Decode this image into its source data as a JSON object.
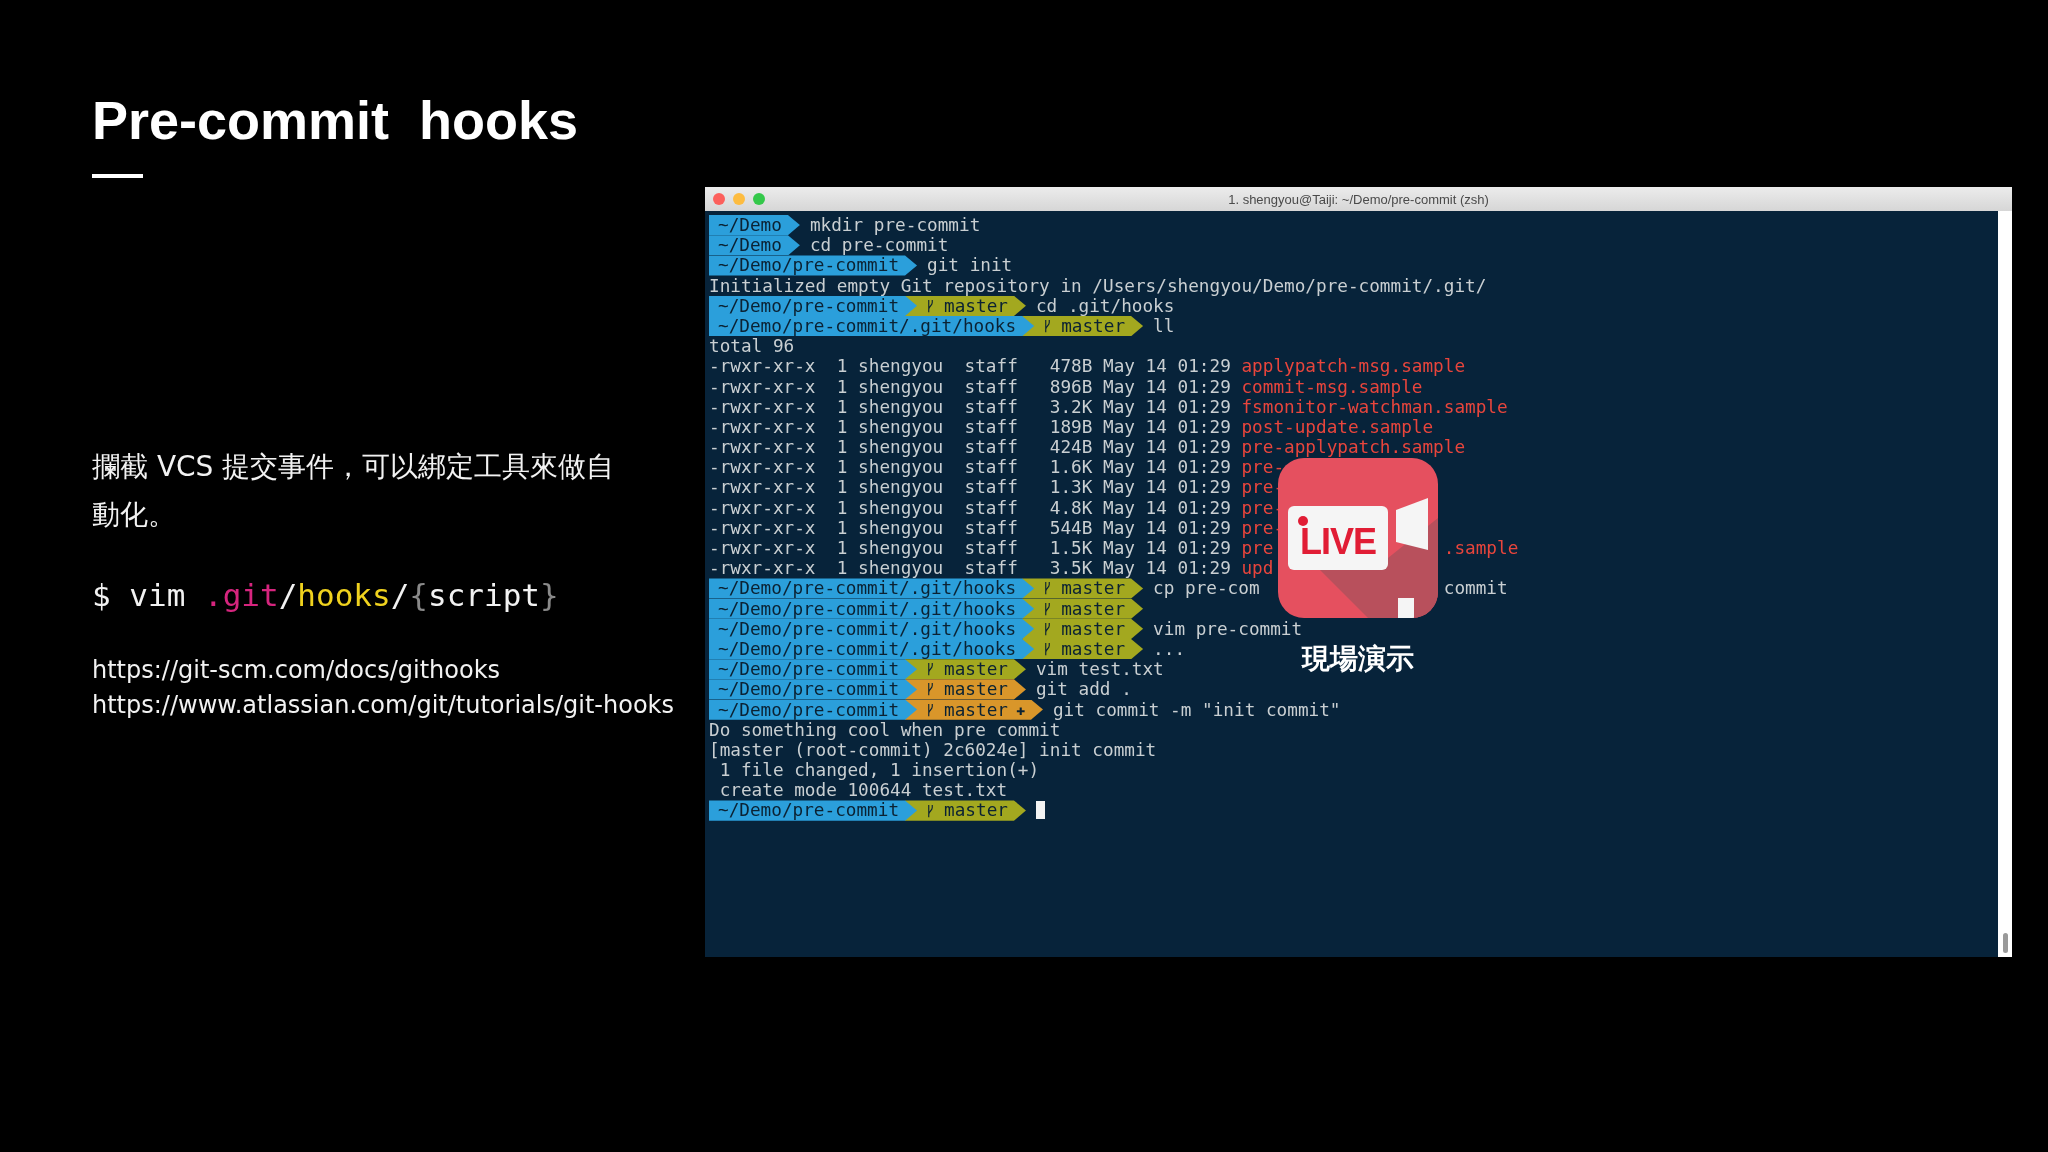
{
  "slide": {
    "title": "Pre-commit  hooks",
    "description": "攔截 VCS 提交事件，可以綁定工具來做自動化。",
    "command": [
      {
        "text": "$ vim ",
        "color": "#f2f2f2"
      },
      {
        "text": ".git",
        "color": "#d6257e"
      },
      {
        "text": "/",
        "color": "#f2f2f2"
      },
      {
        "text": "hooks",
        "color": "#f0d21e"
      },
      {
        "text": "/",
        "color": "#f2f2f2"
      },
      {
        "text": "{",
        "color": "#8a8a8a"
      },
      {
        "text": "script",
        "color": "#f2f2f2"
      },
      {
        "text": "}",
        "color": "#8a8a8a"
      }
    ],
    "links": [
      "https://git-scm.com/docs/githooks",
      "https://www.atlassian.com/git/tutorials/git-hooks"
    ]
  },
  "terminal": {
    "title": "1. shengyou@Taiji: ~/Demo/pre-commit (zsh)",
    "lines": [
      {
        "kind": "prompt",
        "path": "~/Demo",
        "command": "mkdir pre-commit"
      },
      {
        "kind": "prompt",
        "path": "~/Demo",
        "command": "cd pre-commit"
      },
      {
        "kind": "prompt",
        "path": "~/Demo/pre-commit",
        "command": "git init"
      },
      {
        "kind": "output",
        "text": "Initialized empty Git repository in /Users/shengyou/Demo/pre-commit/.git/"
      },
      {
        "kind": "prompt",
        "path": "~/Demo/pre-commit",
        "branch": "master",
        "dirty": false,
        "command": "cd .git/hooks"
      },
      {
        "kind": "prompt",
        "path": "~/Demo/pre-commit/.git/hooks",
        "branch": "master",
        "dirty": false,
        "command": "ll"
      },
      {
        "kind": "output",
        "text": "total 96"
      },
      {
        "kind": "file",
        "meta": "-rwxr-xr-x  1 shengyou  staff   478B May 14 01:29",
        "name": "applypatch-msg.sample"
      },
      {
        "kind": "file",
        "meta": "-rwxr-xr-x  1 shengyou  staff   896B May 14 01:29",
        "name": "commit-msg.sample"
      },
      {
        "kind": "file",
        "meta": "-rwxr-xr-x  1 shengyou  staff   3.2K May 14 01:29",
        "name": "fsmonitor-watchman.sample"
      },
      {
        "kind": "file",
        "meta": "-rwxr-xr-x  1 shengyou  staff   189B May 14 01:29",
        "name": "post-update.sample"
      },
      {
        "kind": "file",
        "meta": "-rwxr-xr-x  1 shengyou  staff   424B May 14 01:29",
        "name": "pre-applypatch.sample"
      },
      {
        "kind": "file",
        "meta": "-rwxr-xr-x  1 shengyou  staff   1.6K May 14 01:29",
        "name": "pre-"
      },
      {
        "kind": "file",
        "meta": "-rwxr-xr-x  1 shengyou  staff   1.3K May 14 01:29",
        "name": "pre-"
      },
      {
        "kind": "file",
        "meta": "-rwxr-xr-x  1 shengyou  staff   4.8K May 14 01:29",
        "name": "pre-"
      },
      {
        "kind": "file",
        "meta": "-rwxr-xr-x  1 shengyou  staff   544B May 14 01:29",
        "name": "pre-"
      },
      {
        "kind": "file",
        "meta": "-rwxr-xr-x  1 shengyou  staff   1.5K May 14 01:29",
        "name": "pre",
        "tail": ".sample"
      },
      {
        "kind": "file",
        "meta": "-rwxr-xr-x  1 shengyou  staff   3.5K May 14 01:29",
        "name": "upd"
      },
      {
        "kind": "prompt",
        "path": "~/Demo/pre-commit/.git/hooks",
        "branch": "master",
        "dirty": false,
        "command": "cp pre-com",
        "tail": "commit"
      },
      {
        "kind": "prompt",
        "path": "~/Demo/pre-commit/.git/hooks",
        "branch": "master",
        "dirty": false
      },
      {
        "kind": "prompt",
        "path": "~/Demo/pre-commit/.git/hooks",
        "branch": "master",
        "dirty": false,
        "command": "vim pre-commit"
      },
      {
        "kind": "prompt",
        "path": "~/Demo/pre-commit/.git/hooks",
        "branch": "master",
        "dirty": false,
        "command": "..."
      },
      {
        "kind": "prompt",
        "path": "~/Demo/pre-commit",
        "branch": "master",
        "dirty": false,
        "command": "vim test.txt"
      },
      {
        "kind": "prompt",
        "path": "~/Demo/pre-commit",
        "branch": "master",
        "dirty": true,
        "command": "git add ."
      },
      {
        "kind": "prompt",
        "path": "~/Demo/pre-commit",
        "branch": "master",
        "dirty": true,
        "staged_mark": "✚",
        "command": "git commit -m \"init commit\""
      },
      {
        "kind": "output",
        "text": "Do something cool when pre commit"
      },
      {
        "kind": "output",
        "text": "[master (root-commit) 2c6024e] init commit"
      },
      {
        "kind": "output",
        "text": " 1 file changed, 1 insertion(+)"
      },
      {
        "kind": "output",
        "text": " create mode 100644 test.txt"
      },
      {
        "kind": "prompt",
        "path": "~/Demo/pre-commit",
        "branch": "master",
        "dirty": false,
        "cursor": true
      }
    ]
  },
  "live_overlay": {
    "label": "LIVE",
    "caption": "現場演示"
  }
}
